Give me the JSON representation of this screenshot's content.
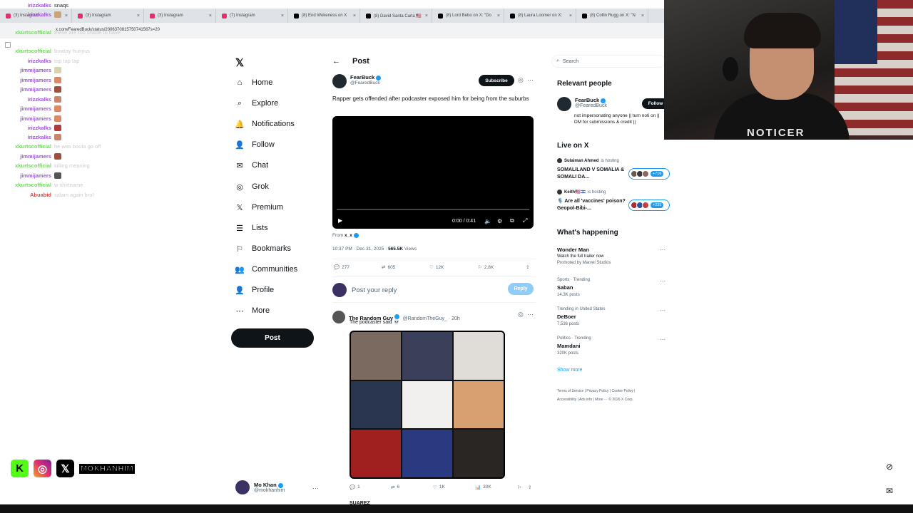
{
  "browser": {
    "tabs": [
      {
        "title": "(3) Instagram",
        "color": "#e1306c"
      },
      {
        "title": "(3) Instagram",
        "color": "#e1306c"
      },
      {
        "title": "(3) Instagram",
        "color": "#e1306c"
      },
      {
        "title": "(7) Instagram",
        "color": "#e1306c"
      },
      {
        "title": "(8) End Wokeness on X",
        "color": "#000000"
      },
      {
        "title": "(8) David Santa Carla 🇺🇸",
        "color": "#000000"
      },
      {
        "title": "(8) Lord Bebo on X: \"Do",
        "color": "#000000"
      },
      {
        "title": "(8) Laura Loomer on X:",
        "color": "#000000"
      },
      {
        "title": "(8) Collin Rugg on X: \"N",
        "color": "#000000"
      }
    ],
    "url": "x.com/FearedBuck/status/2006370815750741567s=20"
  },
  "chat": [
    {
      "user": "irizzkalks",
      "msg": "snaqs",
      "color": "#9b59d0",
      "msg_color": "#222222"
    },
    {
      "user": "irizzkalks",
      "msg": "",
      "color": "#9b59d0",
      "emote": "#c9a37b"
    },
    {
      "user": "xkurtscofficial",
      "msg": "these are too shade to have",
      "color": "#7bd36a"
    },
    {
      "user": "xkurtscofficial",
      "msg": "bowtay hunyus",
      "color": "#7bd36a"
    },
    {
      "user": "irizzkalks",
      "msg": "tap tap tap",
      "color": "#9b59d0"
    },
    {
      "user": "jimmijamers",
      "msg": "",
      "color": "#9b59d0",
      "emote": "#d9d2b0"
    },
    {
      "user": "jimmijamers",
      "msg": "",
      "color": "#9b59d0",
      "emote": "#d88a6a"
    },
    {
      "user": "jimmijamers",
      "msg": "",
      "color": "#9b59d0",
      "emote": "#a0503a"
    },
    {
      "user": "irizzkalks",
      "msg": "",
      "color": "#9b59d0",
      "emote": "#c9866a"
    },
    {
      "user": "jimmijamers",
      "msg": "",
      "color": "#9b59d0",
      "emote": "#d88a6a"
    },
    {
      "user": "jimmijamers",
      "msg": "",
      "color": "#9b59d0",
      "emote": "#d88a6a"
    },
    {
      "user": "irizzkalks",
      "msg": "",
      "color": "#9b59d0",
      "emote": "#b03a3a"
    },
    {
      "user": "irizzkalks",
      "msg": "",
      "color": "#9b59d0",
      "emote": "#c9866a"
    },
    {
      "user": "xkurtscofficial",
      "msg": "he was bouta go off",
      "color": "#7bd36a"
    },
    {
      "user": "jimmijamers",
      "msg": "",
      "color": "#9b59d0",
      "emote": "#a0503a"
    },
    {
      "user": "xkurtscofficial",
      "msg": "killing meaning",
      "color": "#7bd36a"
    },
    {
      "user": "jimmijamers",
      "msg": "",
      "color": "#9b59d0",
      "emote": "#555555"
    },
    {
      "user": "xkurtscofficial",
      "msg": "w shirtname",
      "color": "#7bd36a"
    },
    {
      "user": "Abuabid",
      "msg": "salam again bro!",
      "color": "#d24b4b"
    }
  ],
  "nav": {
    "items": [
      {
        "label": "Home",
        "icon": "⌂"
      },
      {
        "label": "Explore",
        "icon": "⌕"
      },
      {
        "label": "Notifications",
        "icon": "🔔"
      },
      {
        "label": "Follow",
        "icon": "👤"
      },
      {
        "label": "Chat",
        "icon": "✉"
      },
      {
        "label": "Grok",
        "icon": "◎"
      },
      {
        "label": "Premium",
        "icon": "𝕏"
      },
      {
        "label": "Lists",
        "icon": "☰"
      },
      {
        "label": "Bookmarks",
        "icon": "⚐"
      },
      {
        "label": "Communities",
        "icon": "👥"
      },
      {
        "label": "Profile",
        "icon": "👤"
      },
      {
        "label": "More",
        "icon": "⋯"
      }
    ],
    "post_label": "Post",
    "account": {
      "name": "Mo Khan",
      "handle": "@mokhanhim"
    }
  },
  "post": {
    "header_title": "Post",
    "author_name": "FearBuck",
    "author_handle": "@FearedBuck",
    "subscribe_label": "Subscribe",
    "text": "Rapper gets offended after podcaster exposed him for being from the suburbs",
    "video_time": "0:00 / 0:41",
    "from_prefix": "From",
    "from_user": "x_x",
    "timestamp": "10:37 PM · Dec 31, 2025 ·",
    "views": "565.5K",
    "views_label": "Views",
    "stats": {
      "replies": "277",
      "reposts": "605",
      "likes": "12K",
      "bookmarks": "2.8K"
    },
    "reply_placeholder": "Post your reply",
    "reply_button": "Reply"
  },
  "reply_tweet": {
    "author_name": "The Random Guy",
    "author_handle": "@RandomTheGuy_ · 20h",
    "text": "The podcaster said 💀",
    "stats": {
      "replies": "1",
      "reposts": "6",
      "likes": "1K",
      "views": "30K"
    },
    "next_author": "SUAREZ"
  },
  "collage_colors": [
    "#7a6a60",
    "#3a3f5a",
    "#e0dcd8",
    "#2a3550",
    "#f2f0ee",
    "#d8a070",
    "#a02020",
    "#2a3a80",
    "#2a2624"
  ],
  "sidebar": {
    "search_placeholder": "Search",
    "relevant_title": "Relevant people",
    "person": {
      "name": "FearBuck",
      "handle": "@FearedBuck",
      "bio": "not impersonating anyone || turn noti on || DM for submissions & credit ||"
    },
    "follow_label": "Follow",
    "live_title": "Live on X",
    "live": [
      {
        "host": "Sulaiman Ahmed",
        "hosting": "is hosting",
        "title": "SOMALILAND V SOMALIA & SOMALI DA...",
        "count": "+716"
      },
      {
        "host": "Keith🇺🇸🇮🇱",
        "hosting": "is hosting",
        "title": "🎙️ Are all 'vaccines' poison? Geopol-Bibi-...",
        "count": "+235"
      }
    ],
    "happening_title": "What's happening",
    "trends": [
      {
        "category": "",
        "title": "Wonder Man",
        "sub": "Watch the full trailer now",
        "posts": "Promoted by Marvel Studios"
      },
      {
        "category": "Sports · Trending",
        "title": "Saban",
        "sub": "",
        "posts": "14.3K posts"
      },
      {
        "category": "Trending in United States",
        "title": "DeBoer",
        "sub": "",
        "posts": "7,536 posts"
      },
      {
        "category": "Politics · Trending",
        "title": "Mamdani",
        "sub": "",
        "posts": "320K posts"
      }
    ],
    "show_more": "Show more",
    "footer_line1": "Terms of Service  |  Privacy Policy  |  Cookie Policy  |",
    "footer_line2": "Accessibility  |  Ads info  |  More ···  © 2026 X Corp."
  },
  "stream": {
    "overlay_brand": "NOTICER",
    "social_handle": "MOKHANHIM"
  }
}
